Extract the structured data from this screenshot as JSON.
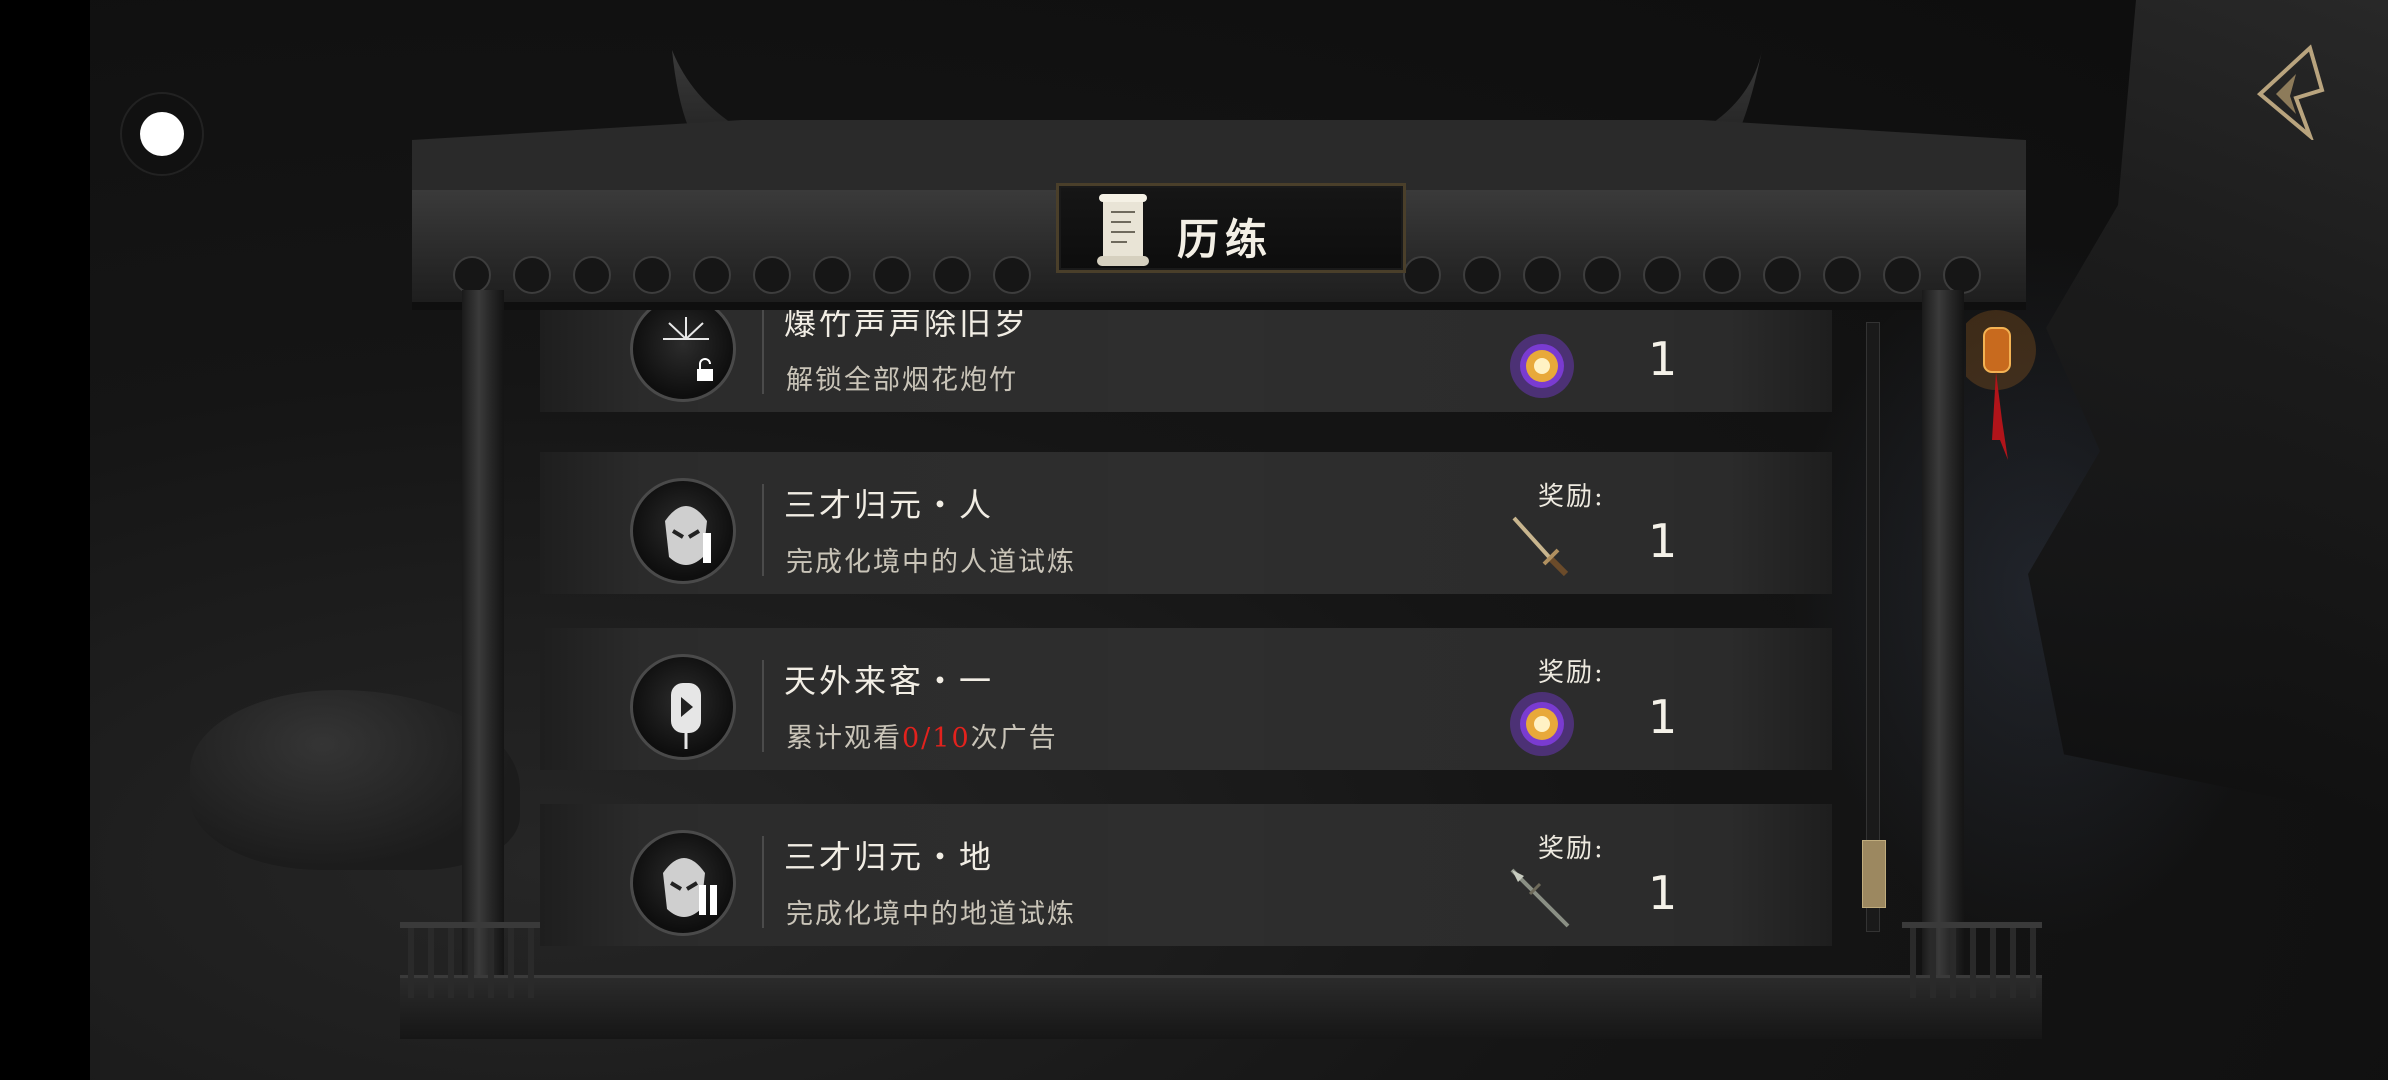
{
  "panel": {
    "title": "历练"
  },
  "list": {
    "reward_label": "奖励:",
    "items": [
      {
        "name": "爆竹声声除旧岁",
        "desc": "解锁全部烟花炮竹",
        "reward_icon": "golden-orb-icon",
        "reward_qty": "1",
        "badge_icon": "fireworks-lock-icon"
      },
      {
        "name": "三才归元・人",
        "desc": "完成化境中的人道试炼",
        "reward_icon": "dagger-icon",
        "reward_qty": "1",
        "badge_icon": "mask-roman-one-icon"
      },
      {
        "name": "天外来客・一",
        "desc_prefix": "累计观看",
        "desc_progress": "0/10",
        "desc_suffix": "次广告",
        "reward_icon": "golden-orb-icon",
        "reward_qty": "1",
        "badge_icon": "video-lantern-icon"
      },
      {
        "name": "三才归元・地",
        "desc": "完成化境中的地道试炼",
        "reward_icon": "spear-icon",
        "reward_qty": "1",
        "badge_icon": "mask-roman-two-icon"
      }
    ]
  },
  "colors": {
    "progress_highlight": "#e2221d",
    "scroll_thumb": "#9c8860",
    "orb_glow": "#8a3cff"
  },
  "scroll": {
    "position_fraction": 0.9
  }
}
